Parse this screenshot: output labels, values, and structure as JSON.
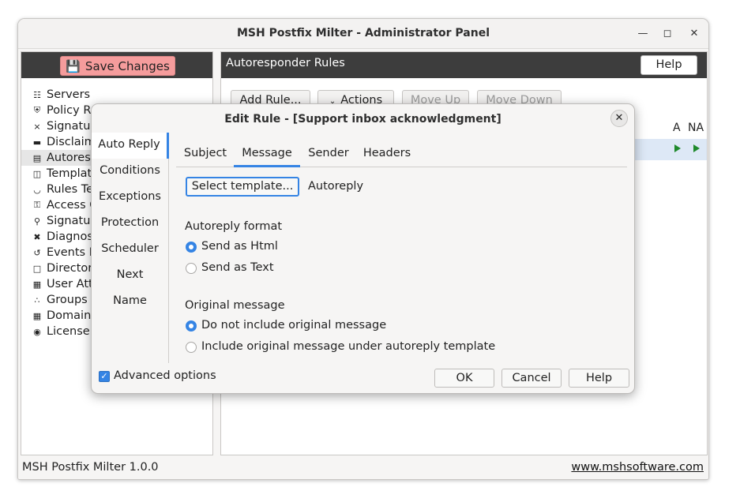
{
  "window": {
    "title": "MSH Postfix Milter - Administrator Panel",
    "minimize_icon": "minimize-icon",
    "maximize_icon": "maximize-icon",
    "close_icon": "close-icon"
  },
  "left": {
    "save_label": "Save Changes",
    "nav": [
      {
        "label": "Servers",
        "icon": "sitemap-icon"
      },
      {
        "label": "Policy Ru",
        "icon": "shield-icon"
      },
      {
        "label": "Signature",
        "icon": "signature-icon"
      },
      {
        "label": "Disclaim",
        "icon": "monitor-icon"
      },
      {
        "label": "Autoresp",
        "icon": "message-icon"
      },
      {
        "label": "Template",
        "icon": "template-icon"
      },
      {
        "label": "Rules Te",
        "icon": "flask-icon"
      },
      {
        "label": "Access C",
        "icon": "key-icon"
      },
      {
        "label": "Signature",
        "icon": "location-icon"
      },
      {
        "label": "Diagnost",
        "icon": "tools-icon"
      },
      {
        "label": "Events H",
        "icon": "history-icon"
      },
      {
        "label": "Directory",
        "icon": "folder-icon"
      },
      {
        "label": "User Attr",
        "icon": "id-card-icon"
      },
      {
        "label": "Groups",
        "icon": "group-icon"
      },
      {
        "label": "Domains",
        "icon": "building-icon"
      },
      {
        "label": "License -",
        "icon": "award-icon"
      }
    ]
  },
  "right": {
    "title": "Autoresponder Rules",
    "help": "Help",
    "toolbar": {
      "add_rule": "Add Rule...",
      "actions": "Actions",
      "move_up": "Move Up",
      "move_down": "Move Down"
    },
    "columns": {
      "a": "A",
      "na": "NA"
    }
  },
  "status": {
    "version": "MSH Postfix Milter 1.0.0",
    "website": "www.mshsoftware.com"
  },
  "dialog": {
    "title": "Edit Rule - [Support inbox acknowledgment]",
    "side_tabs": [
      "Auto Reply",
      "Conditions",
      "Exceptions",
      "Protection",
      "Scheduler",
      "Next",
      "Name"
    ],
    "top_tabs": [
      "Subject",
      "Message",
      "Sender",
      "Headers"
    ],
    "select_template": "Select template...",
    "template_name": "Autoreply",
    "format_label": "Autoreply format",
    "format_html": "Send as Html",
    "format_text": "Send as Text",
    "format_selected": "html",
    "original_label": "Original message",
    "original_no": "Do not include original message",
    "original_yes": "Include original message under autoreply template",
    "original_selected": "no",
    "advanced_options": "Advanced options",
    "advanced_checked": true,
    "ok": "OK",
    "cancel": "Cancel",
    "help": "Help"
  },
  "colors": {
    "accent": "#3584e4",
    "save_button": "#f59c9c",
    "header_bar": "#3d3d3d",
    "enabled_arrow": "#1f8a2c"
  }
}
